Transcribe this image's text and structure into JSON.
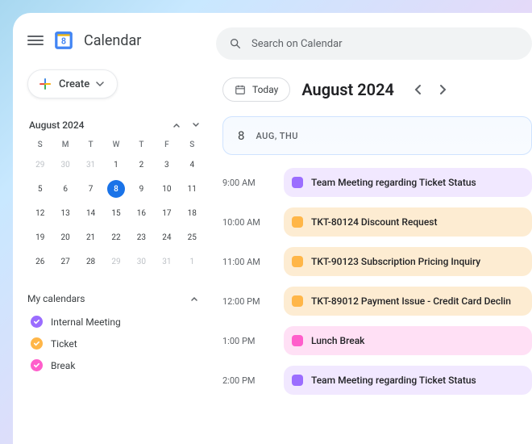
{
  "header": {
    "app_title": "Calendar",
    "search_placeholder": "Search on Calendar"
  },
  "sidebar": {
    "create_label": "Create",
    "minical": {
      "title": "August  2024",
      "dows": [
        "S",
        "M",
        "T",
        "W",
        "T",
        "F",
        "S"
      ],
      "days": [
        {
          "n": "29",
          "other": true
        },
        {
          "n": "30",
          "other": true
        },
        {
          "n": "31",
          "other": true
        },
        {
          "n": "1"
        },
        {
          "n": "2"
        },
        {
          "n": "3"
        },
        {
          "n": "4"
        },
        {
          "n": "5"
        },
        {
          "n": "6"
        },
        {
          "n": "7"
        },
        {
          "n": "8",
          "today": true
        },
        {
          "n": "9"
        },
        {
          "n": "10"
        },
        {
          "n": "11"
        },
        {
          "n": "12"
        },
        {
          "n": "13"
        },
        {
          "n": "14"
        },
        {
          "n": "15"
        },
        {
          "n": "16"
        },
        {
          "n": "17"
        },
        {
          "n": "18"
        },
        {
          "n": "19"
        },
        {
          "n": "20"
        },
        {
          "n": "21"
        },
        {
          "n": "22"
        },
        {
          "n": "23"
        },
        {
          "n": "24"
        },
        {
          "n": "25"
        },
        {
          "n": "26"
        },
        {
          "n": "27"
        },
        {
          "n": "28"
        },
        {
          "n": "29",
          "other": true
        },
        {
          "n": "30",
          "other": true
        },
        {
          "n": "31",
          "other": true
        },
        {
          "n": "1",
          "other": true
        }
      ]
    },
    "mycalendars": {
      "title": "My calendars",
      "items": [
        {
          "label": "Internal Meeting",
          "color": "#9b6dff"
        },
        {
          "label": "Ticket",
          "color": "#ffb648"
        },
        {
          "label": "Break",
          "color": "#ff5ecb"
        }
      ]
    }
  },
  "main": {
    "today_label": "Today",
    "month_title": "August 2024",
    "day": {
      "num": "8",
      "label": "AUG, THU"
    },
    "events": [
      {
        "time": "9:00 AM",
        "title": "Team Meeting regarding Ticket Status",
        "kind": "purple"
      },
      {
        "time": "10:00 AM",
        "title": "TKT-80124 Discount Request",
        "kind": "orange"
      },
      {
        "time": "11:00 AM",
        "title": "TKT-90123 Subscription Pricing Inquiry",
        "kind": "orange"
      },
      {
        "time": "12:00 PM",
        "title": "TKT-89012 Payment Issue - Credit Card Declin",
        "kind": "orange"
      },
      {
        "time": "1:00 PM",
        "title": "Lunch Break",
        "kind": "pink"
      },
      {
        "time": "2:00 PM",
        "title": "Team Meeting regarding Ticket Status",
        "kind": "purple"
      }
    ]
  }
}
